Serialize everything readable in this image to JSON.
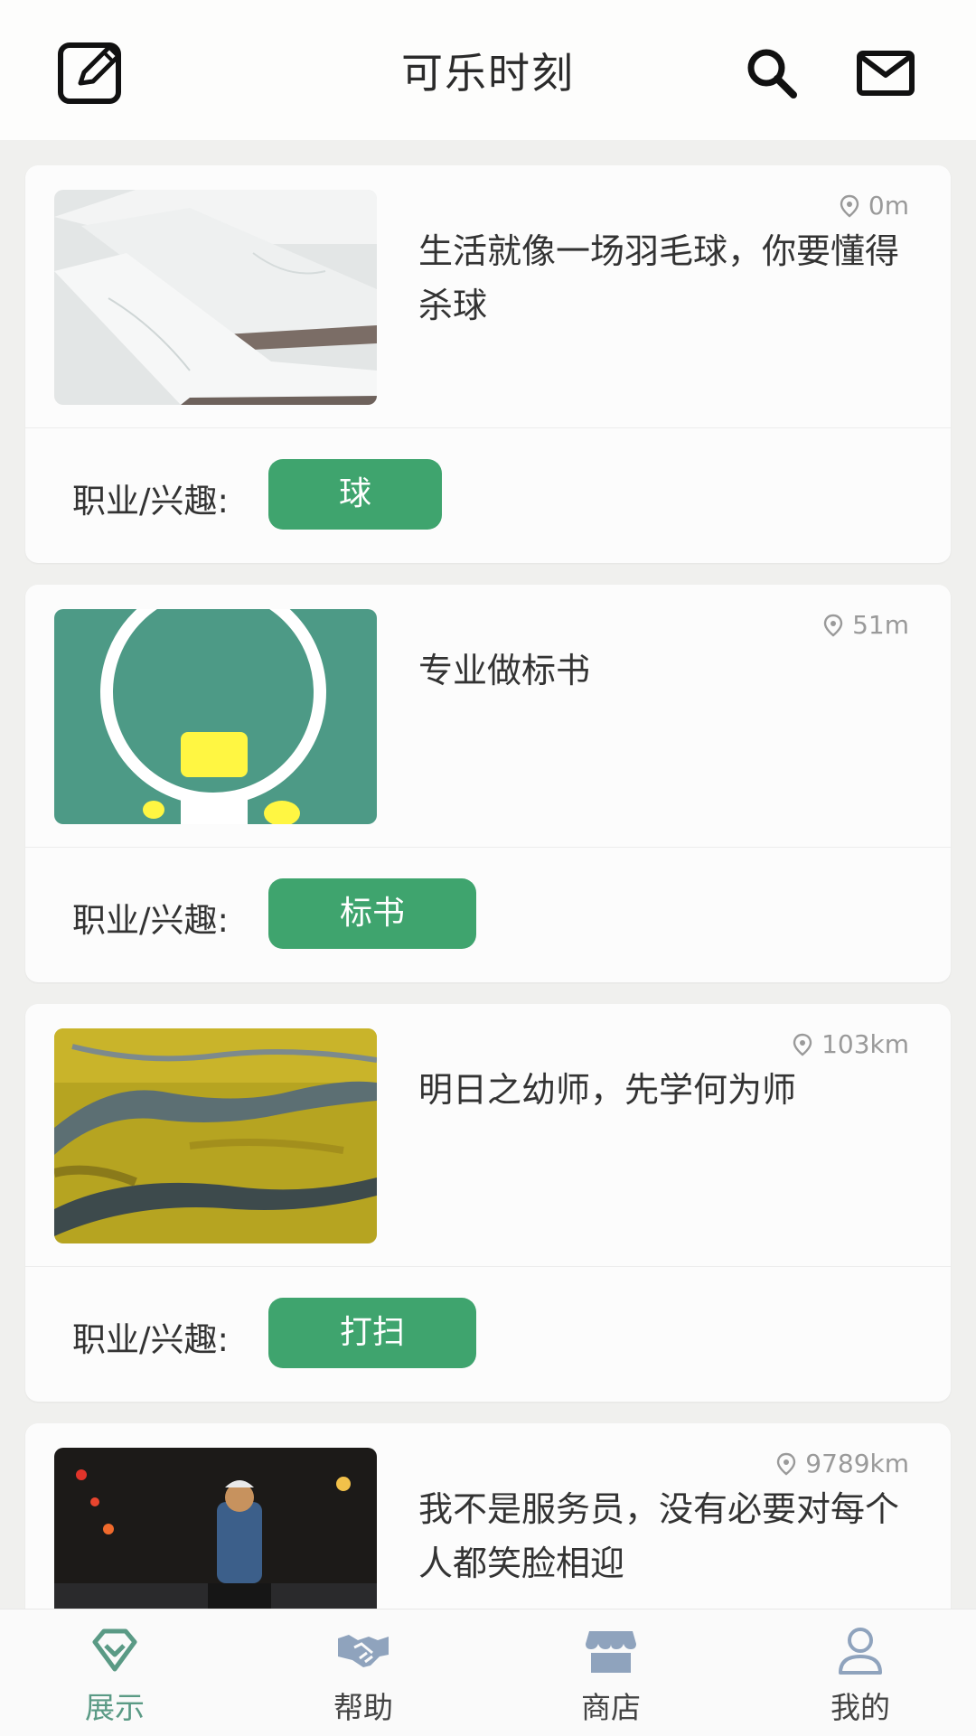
{
  "header": {
    "title": "可乐时刻",
    "edit_icon": "edit-icon",
    "search_icon": "search-icon",
    "mail_icon": "mail-icon"
  },
  "feed": {
    "items": [
      {
        "distance": "0m",
        "description": "生活就像一场羽毛球，你要懂得杀球",
        "tag_label": "职业/兴趣:",
        "tag": "球",
        "image": "marble-slabs-photo"
      },
      {
        "distance": "51m",
        "description": "专业做标书",
        "tag_label": "职业/兴趣:",
        "tag": "标书",
        "image": "green-circle-graphic"
      },
      {
        "distance": "103km",
        "description": "明日之幼师，先学何为师",
        "tag_label": "职业/兴趣:",
        "tag": "打扫",
        "image": "river-grassland-aerial-photo"
      },
      {
        "distance": "9789km",
        "description": "我不是服务员，没有必要对每个人都笑脸相迎",
        "image": "night-cyclist-photo"
      }
    ]
  },
  "tabbar": {
    "active": "展示",
    "tabs": [
      {
        "label": "展示",
        "icon": "diamond-icon"
      },
      {
        "label": "帮助",
        "icon": "handshake-icon"
      },
      {
        "label": "商店",
        "icon": "store-icon"
      },
      {
        "label": "我的",
        "icon": "user-icon"
      }
    ]
  },
  "colors": {
    "accent_green": "#3fa46e",
    "active_tab": "#5a9a85",
    "inactive_tab_icon": "#8fa3bd"
  }
}
